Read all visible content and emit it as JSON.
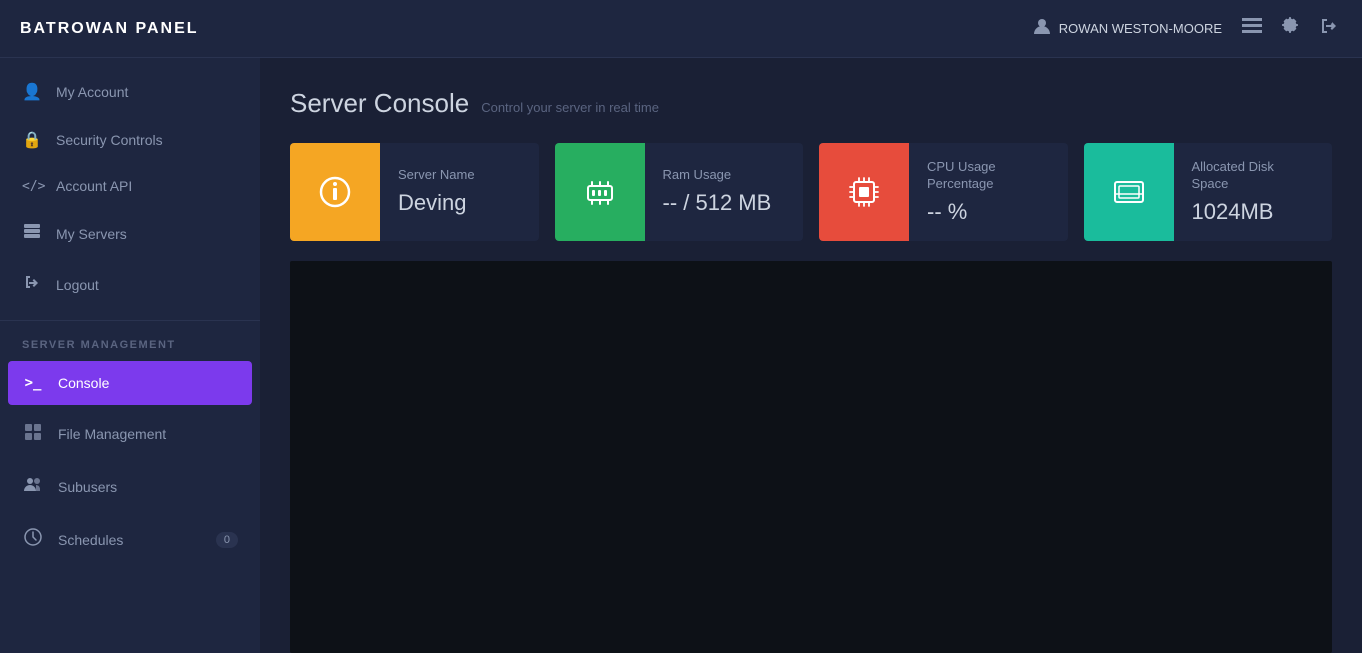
{
  "app": {
    "name": "BATROWAN PANEL"
  },
  "header": {
    "username": "ROWAN WESTON-MOORE",
    "user_icon": "👤",
    "list_icon": "≡",
    "gear_icon": "⚙",
    "logout_icon": "⏻"
  },
  "sidebar": {
    "nav_items": [
      {
        "id": "my-account",
        "label": "My Account",
        "icon": "👤"
      },
      {
        "id": "security-controls",
        "label": "Security Controls",
        "icon": "🔒"
      },
      {
        "id": "account-api",
        "label": "Account API",
        "icon": "</>"
      },
      {
        "id": "my-servers",
        "label": "My Servers",
        "icon": "▤"
      },
      {
        "id": "logout",
        "label": "Logout",
        "icon": "⏻"
      }
    ],
    "section_label": "SERVER MANAGEMENT",
    "mgmt_items": [
      {
        "id": "console",
        "label": "Console",
        "icon": ">_",
        "active": true
      },
      {
        "id": "file-management",
        "label": "File Management",
        "icon": "📋"
      },
      {
        "id": "subusers",
        "label": "Subusers",
        "icon": "👥"
      },
      {
        "id": "schedules",
        "label": "Schedules",
        "icon": "🕐",
        "badge": "0"
      }
    ]
  },
  "page": {
    "title": "Server Console",
    "subtitle": "Control your server in real time"
  },
  "stats": [
    {
      "id": "server-name",
      "icon": "ℹ",
      "icon_color": "orange",
      "label": "Server Name",
      "value": "Deving"
    },
    {
      "id": "ram-usage",
      "icon": "⬡",
      "icon_color": "green",
      "label": "Ram Usage",
      "value": "-- / 512 MB"
    },
    {
      "id": "cpu-usage",
      "icon": "⬡",
      "icon_color": "red",
      "label": "CPU Usage Percentage",
      "value": "-- %"
    },
    {
      "id": "disk-space",
      "icon": "🖥",
      "icon_color": "teal",
      "label": "Allocated Disk Space",
      "value": "1024MB"
    }
  ]
}
